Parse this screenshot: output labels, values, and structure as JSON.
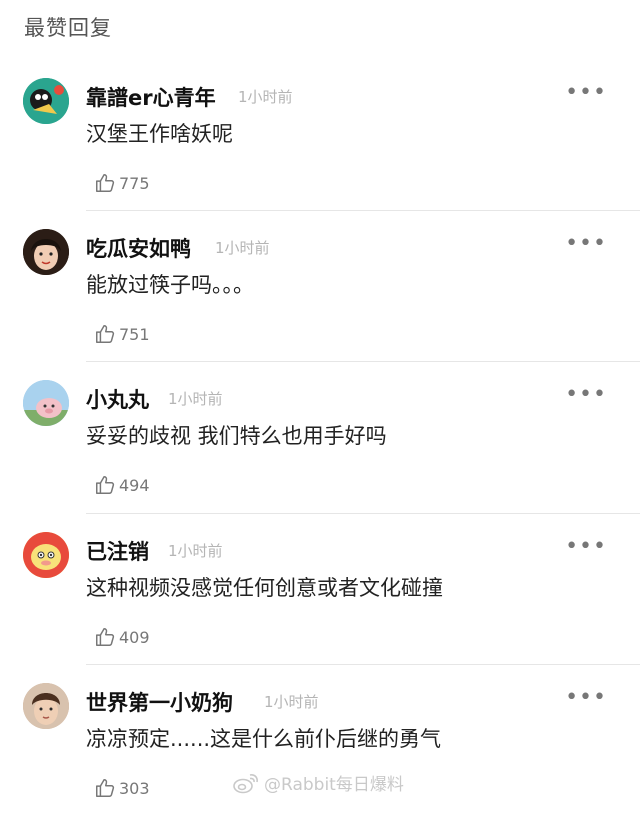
{
  "section_title": "最赞回复",
  "more_label": "•••",
  "comments": [
    {
      "name": "靠譜er心青年",
      "time": "1小时前",
      "text": "汉堡王作啥妖呢",
      "likes": "775"
    },
    {
      "name": "吃瓜安如鸭",
      "time": "1小时前",
      "text": "能放过筷子吗。。。",
      "likes": "751"
    },
    {
      "name": "小丸丸",
      "time": "1小时前",
      "text": "妥妥的歧视 我们特么也用手好吗",
      "likes": "494"
    },
    {
      "name": "已注销",
      "time": "1小时前",
      "text": "这种视频没感觉任何创意或者文化碰撞",
      "likes": "409"
    },
    {
      "name": "世界第一小奶狗",
      "time": "1小时前",
      "text": "凉凉预定......这是什么前仆后继的勇气",
      "likes": "303"
    }
  ],
  "watermark": "@Rabbit每日爆料",
  "icons": {
    "more": "more-horizontal-icon",
    "like": "thumbs-up-icon",
    "watermark": "weibo-logo-icon"
  }
}
